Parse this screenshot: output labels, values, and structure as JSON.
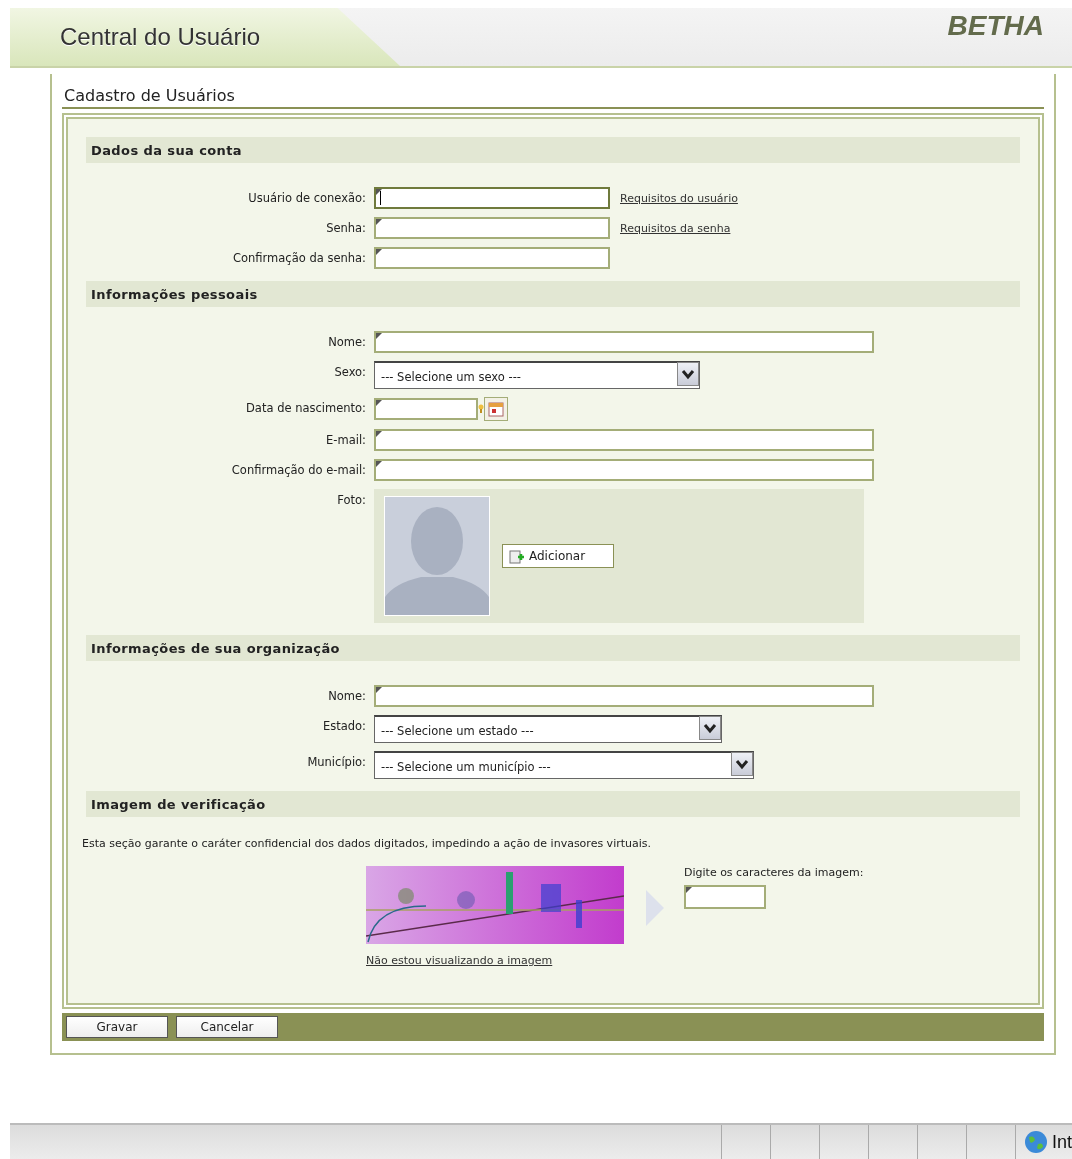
{
  "header": {
    "title": "Central do Usuário",
    "logo": "BETHA"
  },
  "page_title": "Cadastro de Usuários",
  "sections": [
    {
      "title": "Dados da sua conta",
      "fields": [
        {
          "kind": "text",
          "label": "Usuário de conexão:",
          "focused": true,
          "link": "Requisitos do usuário"
        },
        {
          "kind": "text",
          "label": "Senha:",
          "focused": false,
          "link": "Requisitos da senha"
        },
        {
          "kind": "text",
          "label": "Confirmação da senha:",
          "focused": false
        }
      ]
    },
    {
      "title": "Informações pessoais",
      "fields": [
        {
          "kind": "text",
          "label": "Nome:",
          "focused": false
        },
        {
          "kind": "select",
          "label": "Sexo:",
          "value": "--- Selecione um sexo ---"
        },
        {
          "kind": "date",
          "label": "Data de nascimento:",
          "focused": false
        },
        {
          "kind": "text",
          "label": "E-mail:",
          "focused": false
        },
        {
          "kind": "text",
          "label": "Confirmação do e-mail:",
          "focused": false
        },
        {
          "label": "Foto:",
          "button": "Adicionar"
        }
      ]
    },
    {
      "title": "Informações de sua organização",
      "fields": [
        {
          "kind": "text",
          "label": "Nome:",
          "focused": false
        },
        {
          "kind": "select",
          "label": "Estado:",
          "value": "--- Selecione um estado ---"
        },
        {
          "kind": "select",
          "label": "Município:",
          "value": "--- Selecione um município ---"
        }
      ]
    }
  ],
  "verification": {
    "title": "Imagem de verificação",
    "note": "Esta seção garante o caráter confidencial dos dados digitados, impedindo a ação de invasores virtuais.",
    "link": "Não estou visualizando a imagem",
    "field_label": "Digite os caracteres da imagem:"
  },
  "buttons": [
    "Gravar",
    "Cancelar"
  ],
  "status_bar": {
    "zone": "Int"
  }
}
